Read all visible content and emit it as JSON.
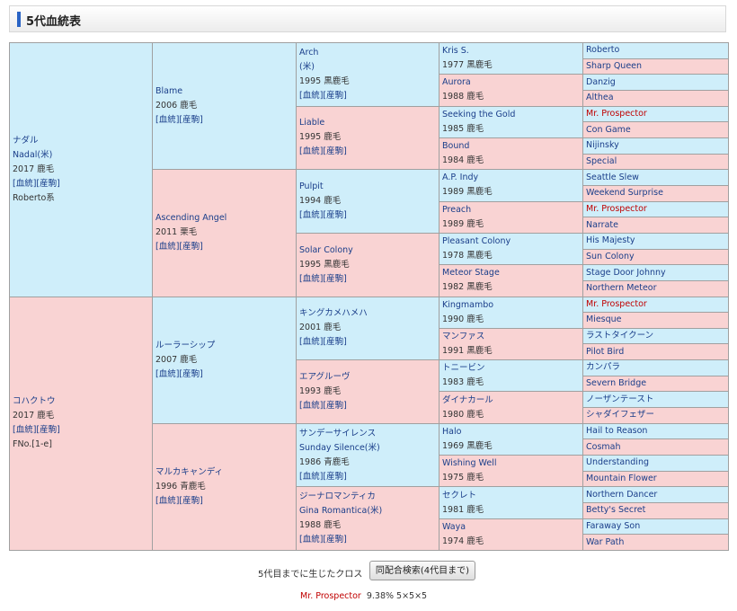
{
  "section_title": "5代血統表",
  "links": {
    "pedigree": "[血統]",
    "foal": "[産駒]"
  },
  "g1": [
    {
      "lines": [
        "ナダル",
        "Nadal(米)",
        "2017 鹿毛"
      ],
      "links": true,
      "extra": "Roberto系",
      "sex": "m"
    },
    {
      "lines": [
        "コハクトウ",
        "2017 鹿毛"
      ],
      "links": true,
      "extra": "FNo.[1-e]",
      "sex": "f"
    }
  ],
  "g2": [
    {
      "lines": [
        "Blame",
        "2006 鹿毛"
      ],
      "links": true,
      "sex": "m"
    },
    {
      "lines": [
        "Ascending Angel",
        "2011 栗毛"
      ],
      "links": true,
      "sex": "f"
    },
    {
      "lines": [
        "ルーラーシップ",
        "2007 鹿毛"
      ],
      "links": true,
      "sex": "m"
    },
    {
      "lines": [
        "マルカキャンディ",
        "1996 青鹿毛"
      ],
      "links": true,
      "sex": "f"
    }
  ],
  "g3": [
    {
      "lines": [
        "Arch",
        "(米)",
        "1995 黒鹿毛"
      ],
      "links": true,
      "sex": "m"
    },
    {
      "lines": [
        "Liable",
        "1995 鹿毛"
      ],
      "links": true,
      "sex": "f"
    },
    {
      "lines": [
        "Pulpit",
        "1994 鹿毛"
      ],
      "links": true,
      "sex": "m"
    },
    {
      "lines": [
        "Solar Colony",
        "1995 黒鹿毛"
      ],
      "links": true,
      "sex": "f"
    },
    {
      "lines": [
        "キングカメハメハ",
        "2001 鹿毛"
      ],
      "links": true,
      "sex": "m"
    },
    {
      "lines": [
        "エアグルーヴ",
        "1993 鹿毛"
      ],
      "links": true,
      "sex": "f"
    },
    {
      "lines": [
        "サンデーサイレンス",
        "Sunday Silence(米)",
        "1986 青鹿毛"
      ],
      "links": true,
      "sex": "m"
    },
    {
      "lines": [
        "ジーナロマンティカ",
        "Gina Romantica(米)",
        "1988 鹿毛"
      ],
      "links": true,
      "sex": "f"
    }
  ],
  "g4": [
    {
      "name": "Kris S.",
      "info": "1977 黒鹿毛",
      "sex": "m"
    },
    {
      "name": "Aurora",
      "info": "1988 鹿毛",
      "sex": "f"
    },
    {
      "name": "Seeking the Gold",
      "info": "1985 鹿毛",
      "sex": "m"
    },
    {
      "name": "Bound",
      "info": "1984 鹿毛",
      "sex": "f"
    },
    {
      "name": "A.P. Indy",
      "info": "1989 黒鹿毛",
      "sex": "m"
    },
    {
      "name": "Preach",
      "info": "1989 鹿毛",
      "sex": "f"
    },
    {
      "name": "Pleasant Colony",
      "info": "1978 黒鹿毛",
      "sex": "m"
    },
    {
      "name": "Meteor Stage",
      "info": "1982 黒鹿毛",
      "sex": "f"
    },
    {
      "name": "Kingmambo",
      "info": "1990 鹿毛",
      "sex": "m"
    },
    {
      "name": "マンファス",
      "info": "1991 黒鹿毛",
      "sex": "f"
    },
    {
      "name": "トニービン",
      "info": "1983 鹿毛",
      "sex": "m"
    },
    {
      "name": "ダイナカール",
      "info": "1980 鹿毛",
      "sex": "f"
    },
    {
      "name": "Halo",
      "info": "1969 黒鹿毛",
      "sex": "m"
    },
    {
      "name": "Wishing Well",
      "info": "1975 鹿毛",
      "sex": "f"
    },
    {
      "name": "セクレト",
      "info": "1981 鹿毛",
      "sex": "m"
    },
    {
      "name": "Waya",
      "info": "1974 鹿毛",
      "sex": "f"
    }
  ],
  "g5": [
    {
      "name": "Roberto",
      "red": false
    },
    {
      "name": "Sharp Queen",
      "red": false
    },
    {
      "name": "Danzig",
      "red": false
    },
    {
      "name": "Althea",
      "red": false
    },
    {
      "name": "Mr. Prospector",
      "red": true
    },
    {
      "name": "Con Game",
      "red": false
    },
    {
      "name": "Nijinsky",
      "red": false
    },
    {
      "name": "Special",
      "red": false
    },
    {
      "name": "Seattle Slew",
      "red": false
    },
    {
      "name": "Weekend Surprise",
      "red": false
    },
    {
      "name": "Mr. Prospector",
      "red": true
    },
    {
      "name": "Narrate",
      "red": false
    },
    {
      "name": "His Majesty",
      "red": false
    },
    {
      "name": "Sun Colony",
      "red": false
    },
    {
      "name": "Stage Door Johnny",
      "red": false
    },
    {
      "name": "Northern Meteor",
      "red": false
    },
    {
      "name": "Mr. Prospector",
      "red": true
    },
    {
      "name": "Miesque",
      "red": false
    },
    {
      "name": "ラストタイクーン",
      "red": false
    },
    {
      "name": "Pilot Bird",
      "red": false
    },
    {
      "name": "カンパラ",
      "red": false
    },
    {
      "name": "Severn Bridge",
      "red": false
    },
    {
      "name": "ノーザンテースト",
      "red": false
    },
    {
      "name": "シャダイフェザー",
      "red": false
    },
    {
      "name": "Hail to Reason",
      "red": false
    },
    {
      "name": "Cosmah",
      "red": false
    },
    {
      "name": "Understanding",
      "red": false
    },
    {
      "name": "Mountain Flower",
      "red": false
    },
    {
      "name": "Northern Dancer",
      "red": false
    },
    {
      "name": "Betty's Secret",
      "red": false
    },
    {
      "name": "Faraway Son",
      "red": false
    },
    {
      "name": "War Path",
      "red": false
    }
  ],
  "cross": {
    "label": "5代目までに生じたクロス",
    "button": "同配合検索(4代目まで)",
    "horse": "Mr. Prospector",
    "detail": "9.38% 5×5×5"
  }
}
